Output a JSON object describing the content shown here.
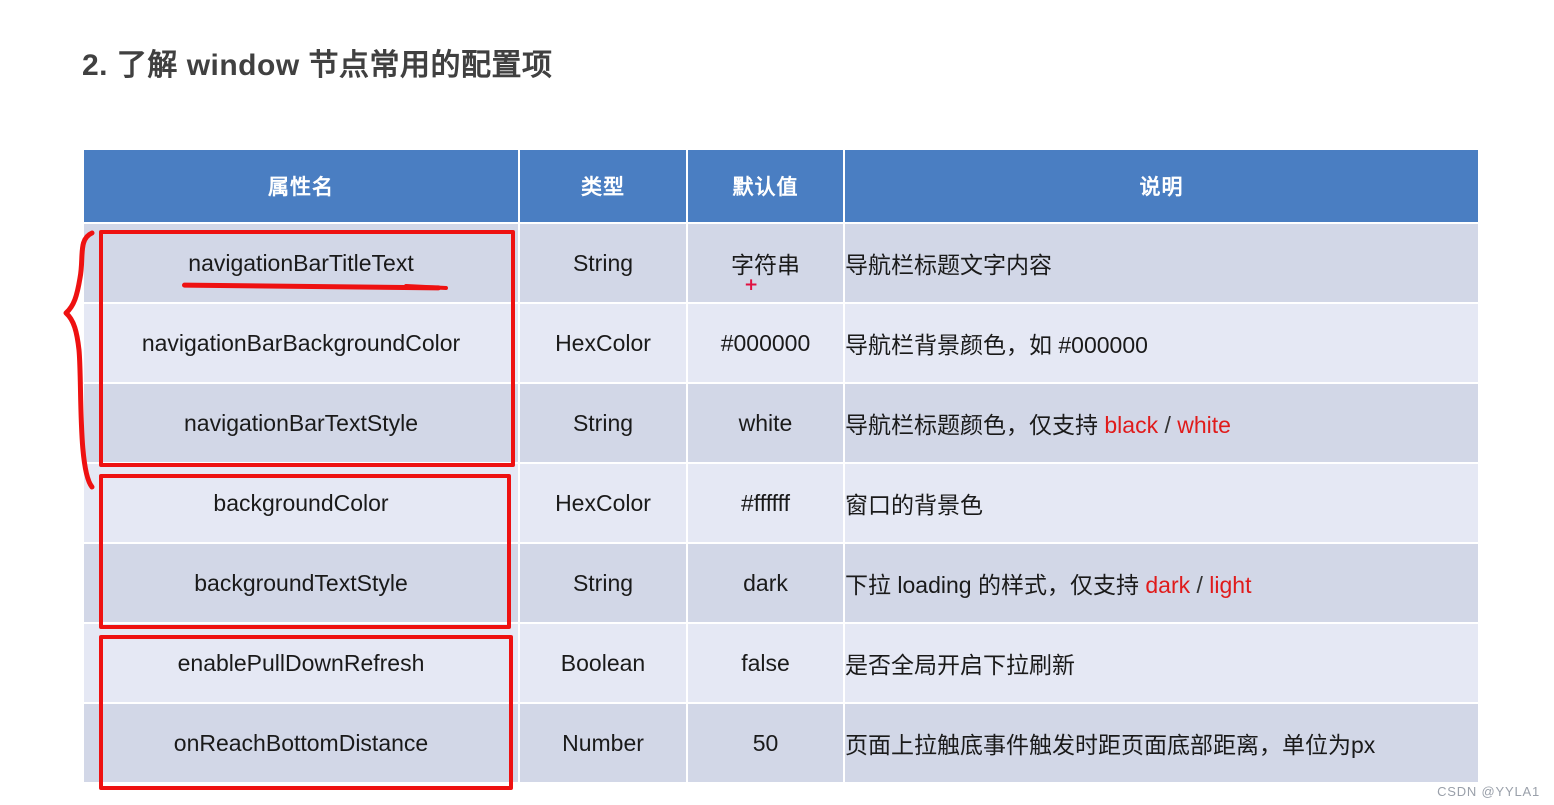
{
  "page": {
    "title": "2. 了解 window 节点常用的配置项",
    "watermark": "CSDN @YYLA1"
  },
  "table": {
    "headers": {
      "property": "属性名",
      "type": "类型",
      "default": "默认值",
      "description": "说明"
    },
    "rows": [
      {
        "property": "navigationBarTitleText",
        "type": "String",
        "default": "字符串",
        "desc_prefix": "导航栏标题文字内容",
        "desc_kw1": "",
        "desc_sep": "",
        "desc_kw2": ""
      },
      {
        "property": "navigationBarBackgroundColor",
        "type": "HexColor",
        "default": "#000000",
        "desc_prefix": "导航栏背景颜色，如 #000000",
        "desc_kw1": "",
        "desc_sep": "",
        "desc_kw2": ""
      },
      {
        "property": "navigationBarTextStyle",
        "type": "String",
        "default": "white",
        "desc_prefix": "导航栏标题颜色，仅支持 ",
        "desc_kw1": "black",
        "desc_sep": " / ",
        "desc_kw2": "white"
      },
      {
        "property": "backgroundColor",
        "type": "HexColor",
        "default": "#ffffff",
        "desc_prefix": "窗口的背景色",
        "desc_kw1": "",
        "desc_sep": "",
        "desc_kw2": ""
      },
      {
        "property": "backgroundTextStyle",
        "type": "String",
        "default": "dark",
        "desc_prefix": "下拉 loading 的样式，仅支持 ",
        "desc_kw1": "dark",
        "desc_sep": " / ",
        "desc_kw2": "light"
      },
      {
        "property": "enablePullDownRefresh",
        "type": "Boolean",
        "default": "false",
        "desc_prefix": "是否全局开启下拉刷新",
        "desc_kw1": "",
        "desc_sep": "",
        "desc_kw2": ""
      },
      {
        "property": "onReachBottomDistance",
        "type": "Number",
        "default": "50",
        "desc_prefix": "页面上拉触底事件触发时距页面底部距离，单位为px",
        "desc_kw1": "",
        "desc_sep": "",
        "desc_kw2": ""
      }
    ]
  },
  "annotations": {
    "color": "#ee1111",
    "brace_label": "navigation-group-brace",
    "boxes": [
      "navigation-bar-group-box",
      "background-group-box",
      "pulldown-group-box"
    ],
    "underline": "navigationBarTitleText-underline",
    "cursor": "+"
  },
  "colors": {
    "header_bg": "#4a7ec2",
    "row_dark": "#d2d7e7",
    "row_light": "#e5e8f4",
    "keyword_red": "#e01b1b"
  }
}
